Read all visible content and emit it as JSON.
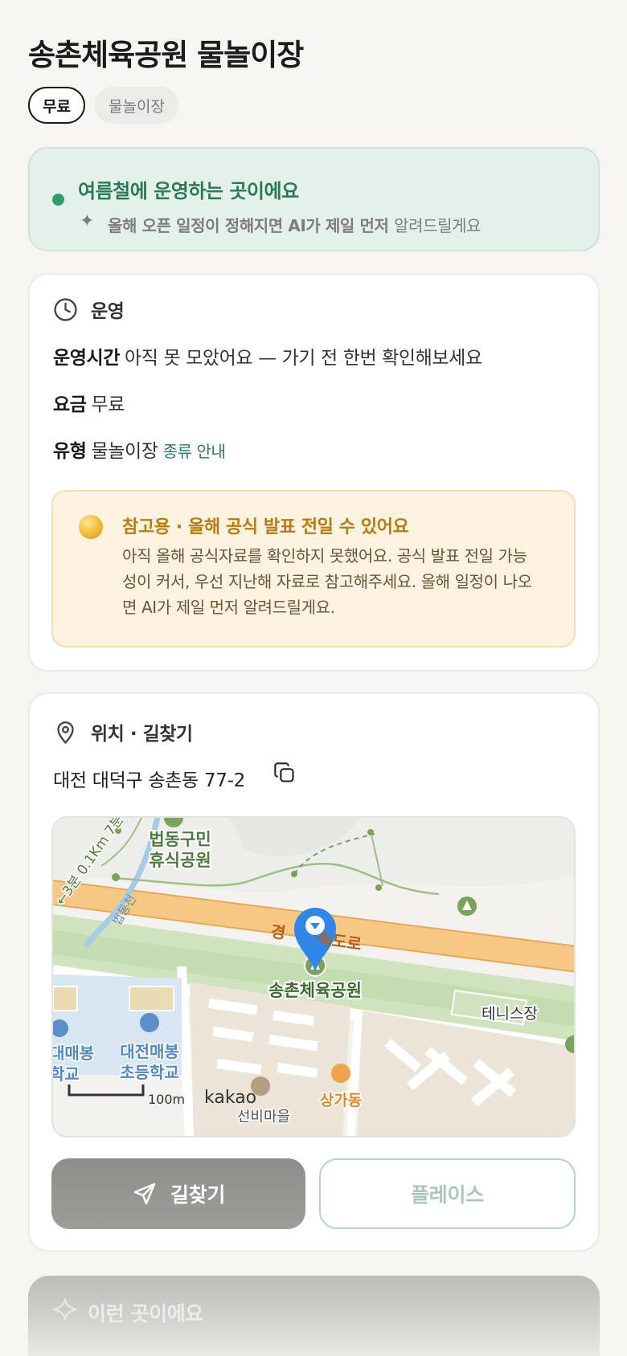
{
  "header": {
    "title": "송촌체육공원 물놀이장",
    "chips": [
      "무료",
      "물놀이장"
    ]
  },
  "season_banner": {
    "headline": "여름철에 운영하는 곳이에요",
    "sub_bold": "올해 오픈 일정이 정해지면 AI가 제일 먼저",
    "sub_light": "알려드릴게요",
    "accent_color": "#2e9d68"
  },
  "operation": {
    "section_title": "운영",
    "hours_label": "운영시간",
    "hours_value": "아직 못 모았어요 — 가기 전 한번 확인해보세요",
    "fee_label": "요금",
    "fee_value": "무료",
    "type_label": "유형",
    "type_value": "물놀이장",
    "type_link": "종류 안내",
    "notice": {
      "title": "참고용 · 올해 공식 발표 전일 수 있어요",
      "body": "아직 올해 공식자료를 확인하지 못했어요. 공식 발표 전일 가능성이 커서, 우선 지난해 자료로 참고해주세요. 올해 일정이 나오면 AI가 제일 먼저 알려드릴게요."
    }
  },
  "location": {
    "section_title": "위치 · 길찾기",
    "address": "대전 대덕구 송촌동 77-2",
    "map": {
      "labels": {
        "park_rest": "법동구민",
        "park_rest2": "휴식공원",
        "trail": "←3분 0.1Km 7분",
        "stream": "법동천",
        "highway_a": "경",
        "highway_b": "속도로",
        "destination": "송촌체육공원",
        "tennis": "테니스장",
        "school_left_a": "대매봉",
        "school_left_b": "학교",
        "school_a": "대전매봉",
        "school_b": "초등학교",
        "scale": "100m",
        "brand": "kakao",
        "village": "선비마을",
        "shop": "상가동"
      }
    },
    "route_button": "길찾기",
    "place_button": "플레이스"
  },
  "next_section": {
    "title": "이런 곳이에요"
  }
}
